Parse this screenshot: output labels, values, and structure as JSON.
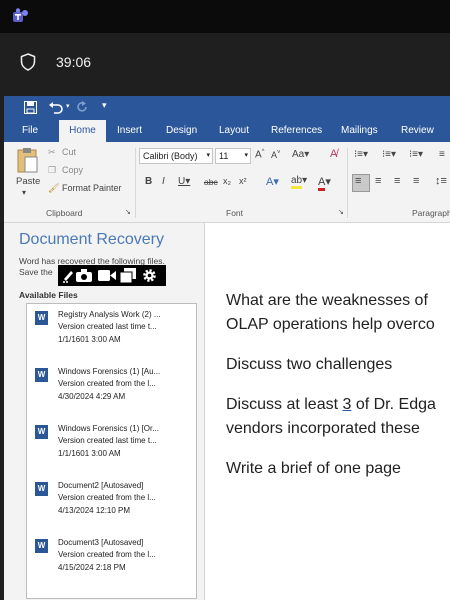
{
  "timer": "39:06",
  "ribbon": {
    "tabs": [
      "File",
      "Home",
      "Insert",
      "Design",
      "Layout",
      "References",
      "Mailings",
      "Review"
    ],
    "clipboard": {
      "paste": "Paste",
      "cut": "Cut",
      "copy": "Copy",
      "format_painter": "Format Painter",
      "group": "Clipboard"
    },
    "font": {
      "name": "Calibri (Body)",
      "size": "11",
      "group": "Font"
    },
    "paragraph_group": "Paragraph"
  },
  "recovery": {
    "title": "Document Recovery",
    "message_line1": "Word has recovered the following files.",
    "message_line2": "Save the",
    "available_files_label": "Available Files",
    "files": [
      {
        "name": "Registry Analysis Work (2)  ...",
        "desc": "Version created last time t...",
        "date": "1/1/1601 3:00 AM"
      },
      {
        "name": "Windows Forensics (1)  [Au...",
        "desc": "Version created from the l...",
        "date": "4/30/2024 4:29 AM"
      },
      {
        "name": "Windows Forensics (1)  [Or...",
        "desc": "Version created last time t...",
        "date": "1/1/1601 3:00 AM"
      },
      {
        "name": "Document2  [Autosaved]",
        "desc": "Version created from the l...",
        "date": "4/13/2024 12:10 PM"
      },
      {
        "name": "Document3  [Autosaved]",
        "desc": "Version created from the l...",
        "date": "4/15/2024 2:18 PM"
      }
    ]
  },
  "document": {
    "p1_line1": "What are the weaknesses of",
    "p1_line2": "OLAP operations help overco",
    "p2": "Discuss two challenges",
    "p3_line1_pre": "Discuss at least ",
    "p3_line1_num": "3",
    "p3_line1_post": " of Dr. Edga",
    "p3_line2": "vendors incorporated these",
    "p4": "Write a brief of one page"
  }
}
